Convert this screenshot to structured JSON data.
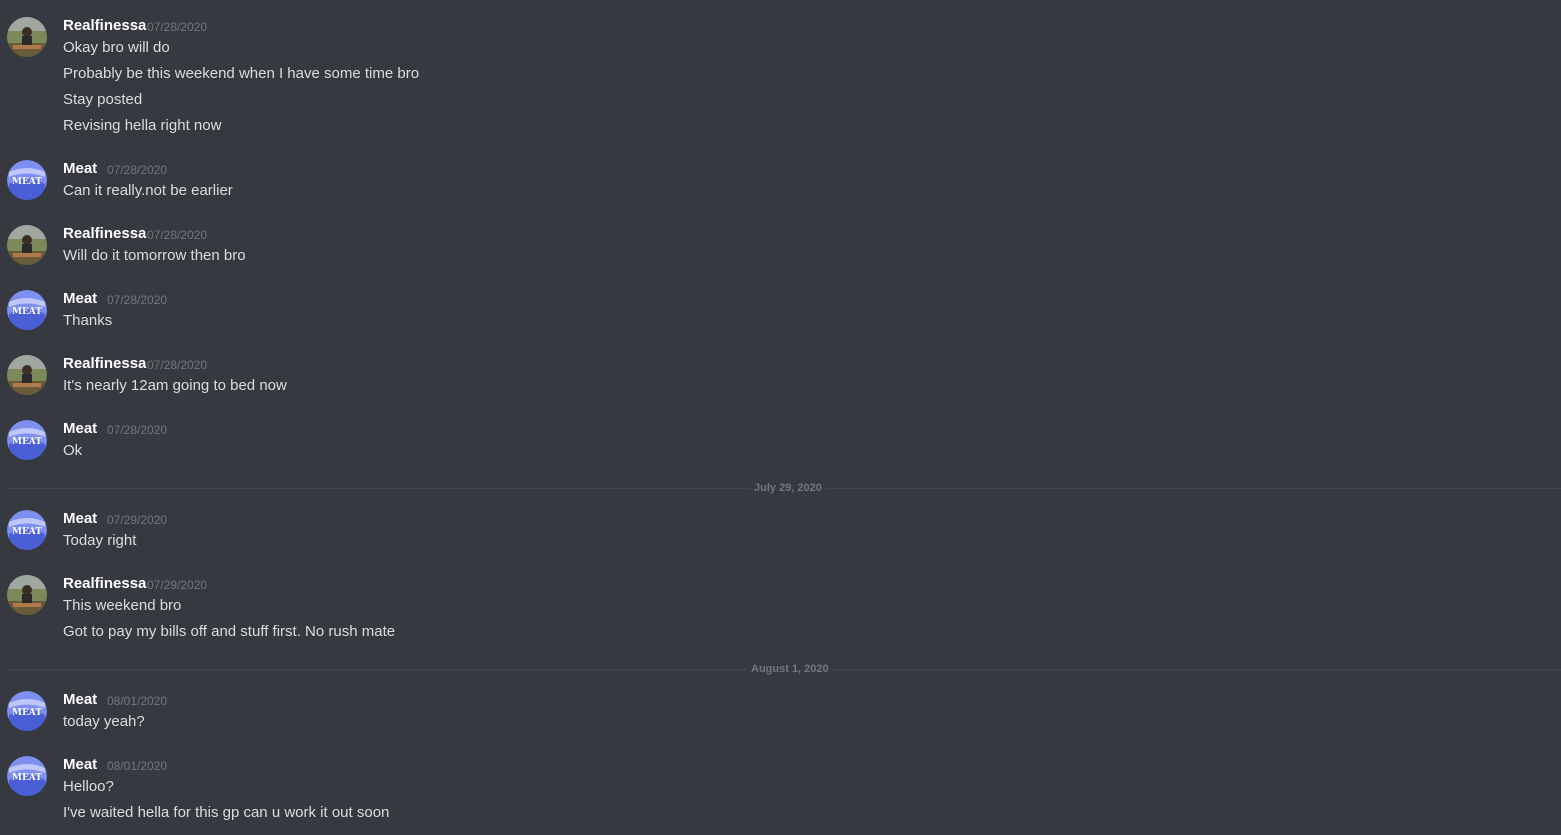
{
  "users": {
    "realfinessa": "Realfinessa",
    "meat": "Meat"
  },
  "avatars": {
    "meat_text": "MEAT"
  },
  "dividers": [
    "July 29, 2020",
    "August 1, 2020"
  ],
  "messages": [
    {
      "author": "Realfinessa",
      "timestamp": "07/28/2020",
      "lines": [
        "Okay bro will do",
        "Probably be this weekend when I have some time bro",
        "Stay posted",
        "Revising hella right now"
      ]
    },
    {
      "author": "Meat",
      "timestamp": "07/28/2020",
      "lines": [
        "Can it really.not be earlier"
      ]
    },
    {
      "author": "Realfinessa",
      "timestamp": "07/28/2020",
      "lines": [
        "Will do it tomorrow then bro"
      ]
    },
    {
      "author": "Meat",
      "timestamp": "07/28/2020",
      "lines": [
        "Thanks"
      ]
    },
    {
      "author": "Realfinessa",
      "timestamp": "07/28/2020",
      "lines": [
        "It's nearly 12am going to bed now"
      ]
    },
    {
      "author": "Meat",
      "timestamp": "07/28/2020",
      "lines": [
        "Ok"
      ]
    },
    {
      "author": "Meat",
      "timestamp": "07/29/2020",
      "lines": [
        "Today right"
      ]
    },
    {
      "author": "Realfinessa",
      "timestamp": "07/29/2020",
      "lines": [
        "This weekend bro",
        "Got to pay my bills off and stuff first. No rush mate"
      ]
    },
    {
      "author": "Meat",
      "timestamp": "08/01/2020",
      "lines": [
        "today yeah?"
      ]
    },
    {
      "author": "Meat",
      "timestamp": "08/01/2020",
      "lines": [
        "Helloo?",
        "I've waited hella for this gp can u work it out soon"
      ]
    }
  ],
  "colors": {
    "background": "#36393f",
    "username": "#ffffff",
    "timestamp": "#72767d",
    "message_text": "#dcddde",
    "divider": "#42454a"
  }
}
